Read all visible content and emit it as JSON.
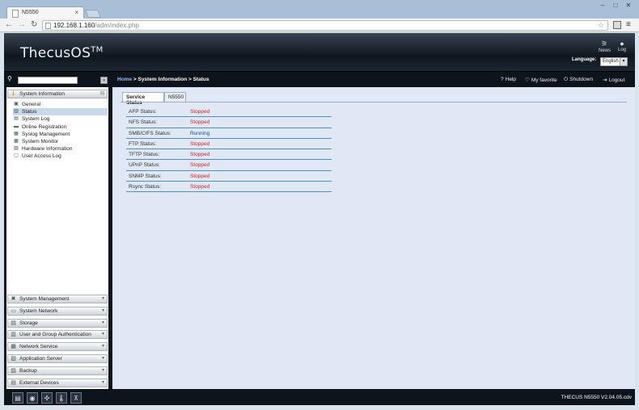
{
  "browser": {
    "tab_title": "N5550",
    "url_host": "192.168.1.160",
    "url_path": "/adm/index.php"
  },
  "header": {
    "logo": "ThecusOS",
    "logo_mark": "TM",
    "news_label": "News",
    "log_label": "Log",
    "language_label": "Language:",
    "language_value": "English"
  },
  "breadcrumb": {
    "home": "Home",
    "sep1": " > ",
    "section": "System Information",
    "sep2": " > ",
    "page": "Status"
  },
  "top_actions": {
    "help": "Help",
    "favorite": "My favorite",
    "shutdown": "Shutdown",
    "logout": "Logout"
  },
  "sidebar": {
    "active_category": "System Information",
    "items": [
      {
        "label": "General",
        "icon": "info-icon"
      },
      {
        "label": "Status",
        "icon": "status-icon"
      },
      {
        "label": "System Log",
        "icon": "log-icon"
      },
      {
        "label": "Online Registration",
        "icon": "registration-icon"
      },
      {
        "label": "Syslog Management",
        "icon": "syslog-icon"
      },
      {
        "label": "System Monitor",
        "icon": "monitor-icon"
      },
      {
        "label": "Hardware Information",
        "icon": "hardware-icon"
      },
      {
        "label": "User Access Log",
        "icon": "access-log-icon"
      }
    ],
    "categories": [
      {
        "label": "System Management",
        "icon": "tools-icon"
      },
      {
        "label": "System Network",
        "icon": "network-icon"
      },
      {
        "label": "Storage",
        "icon": "storage-icon"
      },
      {
        "label": "User and Group Authentication",
        "icon": "users-icon"
      },
      {
        "label": "Network Service",
        "icon": "network-service-icon"
      },
      {
        "label": "Application Server",
        "icon": "app-server-icon"
      },
      {
        "label": "Backup",
        "icon": "backup-icon"
      },
      {
        "label": "External Devices",
        "icon": "external-devices-icon"
      }
    ]
  },
  "content": {
    "tabs": [
      "Service Status",
      "N5550"
    ],
    "rows": [
      {
        "label": "AFP Status:",
        "value": "Stopped"
      },
      {
        "label": "NFS Status:",
        "value": "Stopped"
      },
      {
        "label": "SMB/CIFS Status:",
        "value": "Running"
      },
      {
        "label": "FTP Status:",
        "value": "Stopped"
      },
      {
        "label": "TFTP Status:",
        "value": "Stopped"
      },
      {
        "label": "UPnP Status:",
        "value": "Stopped"
      },
      {
        "label": "SNMP Status:",
        "value": "Stopped"
      },
      {
        "label": "Rsync Status:",
        "value": "Stopped"
      }
    ]
  },
  "footer": {
    "version": "THECUS N5550 V2.04.05.cdv"
  }
}
